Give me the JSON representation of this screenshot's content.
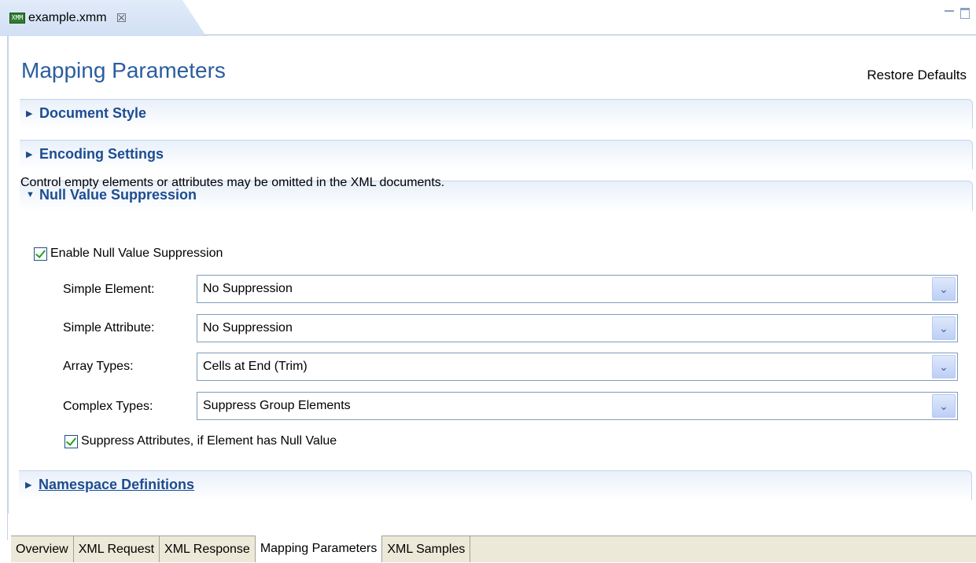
{
  "editor": {
    "tab_icon": "xmm-file-icon",
    "tab_icon_text": "XMM",
    "tab_title": "example.xmm",
    "tab_close": "☒"
  },
  "page": {
    "title": "Mapping Parameters",
    "restore_defaults": "Restore Defaults"
  },
  "sections": {
    "document_style": {
      "title": "Document Style",
      "expanded": false
    },
    "encoding_settings": {
      "title": "Encoding Settings",
      "expanded": false
    },
    "null_value_suppression": {
      "title": "Null Value Suppression",
      "expanded": true,
      "description": "Control empty elements or attributes may be omitted in the XML documents.",
      "enable_label": "Enable Null Value Suppression",
      "enable_checked": true,
      "fields": [
        {
          "label": "Simple Element:",
          "value": "No Suppression"
        },
        {
          "label": "Simple Attribute:",
          "value": "No Suppression"
        },
        {
          "label": "Array Types:",
          "value": "Cells at End (Trim)"
        },
        {
          "label": "Complex Types:",
          "value": "Suppress Group Elements"
        }
      ],
      "suppress_attr_label": "Suppress Attributes, if Element has Null Value",
      "suppress_attr_checked": true
    },
    "namespace_definitions": {
      "title": "Namespace Definitions",
      "expanded": false
    }
  },
  "glyphs": {
    "collapsed": "▶",
    "expanded": "▼",
    "dropdown": "⌄"
  },
  "bottom_tabs": [
    {
      "label": "Overview",
      "active": false
    },
    {
      "label": "XML Request",
      "active": false
    },
    {
      "label": "XML Response",
      "active": false
    },
    {
      "label": "Mapping Parameters",
      "active": true
    },
    {
      "label": "XML Samples",
      "active": false
    }
  ],
  "colors": {
    "title_blue": "#2a5d9e",
    "section_blue": "#1c4d91",
    "check_green": "#21a121"
  }
}
